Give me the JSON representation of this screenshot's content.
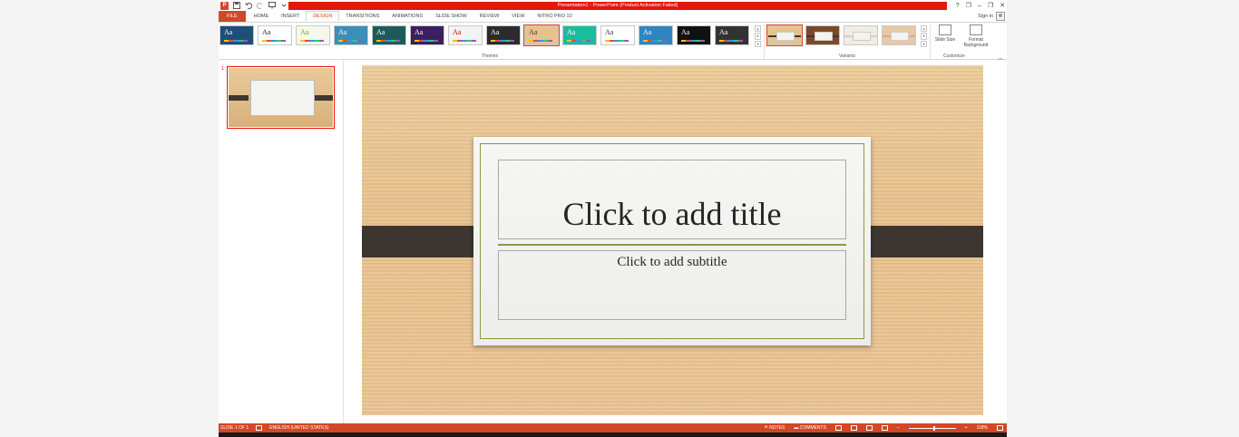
{
  "window": {
    "title": "Presentation1 - PowerPoint (Product Activation Failed)",
    "app_logo": "P",
    "controls": [
      "?",
      "❐",
      "–",
      "❐",
      "✕"
    ]
  },
  "tabs": [
    {
      "label": "FILE"
    },
    {
      "label": "HOME"
    },
    {
      "label": "INSERT"
    },
    {
      "label": "DESIGN"
    },
    {
      "label": "TRANSITIONS"
    },
    {
      "label": "ANIMATIONS"
    },
    {
      "label": "SLIDE SHOW"
    },
    {
      "label": "REVIEW"
    },
    {
      "label": "VIEW"
    },
    {
      "label": "NITRO PRO 10"
    }
  ],
  "active_tab": "DESIGN",
  "signin": {
    "label": "Sign in"
  },
  "ribbon": {
    "groups": {
      "themes": "Themes",
      "variants": "Variants",
      "customize": "Customize"
    },
    "themes": [
      {
        "label": "Aa",
        "bg": "#1f4e79",
        "fg": "#ffffff"
      },
      {
        "label": "Aa",
        "bg": "#ffffff",
        "fg": "#222222"
      },
      {
        "label": "Aa",
        "bg": "#f4f8ea",
        "fg": "#7aa02c"
      },
      {
        "label": "Aa",
        "bg": "#3a8fb7",
        "fg": "#ffffff"
      },
      {
        "label": "Aa",
        "bg": "#1f5a5a",
        "fg": "#ffffff"
      },
      {
        "label": "Aa",
        "bg": "#3b1f5e",
        "fg": "#ffffff"
      },
      {
        "label": "Aa",
        "bg": "#f3f3f3",
        "fg": "#c00000"
      },
      {
        "label": "Aa",
        "bg": "#2b2b2b",
        "fg": "#ffffff"
      },
      {
        "label": "Aa",
        "bg": "#e7c28e",
        "fg": "#3d3630"
      },
      {
        "label": "Aa",
        "bg": "#1abc9c",
        "fg": "#ffffff"
      },
      {
        "label": "Aa",
        "bg": "#ffffff",
        "fg": "#333333"
      },
      {
        "label": "Aa",
        "bg": "#2e86c1",
        "fg": "#ffffff"
      },
      {
        "label": "Aa",
        "bg": "#111111",
        "fg": "#ffffff"
      },
      {
        "label": "Aa",
        "bg": "#333333",
        "fg": "#ffffff"
      }
    ],
    "variants": [
      {
        "bg": "#e7c28e",
        "stripe": "#3d3630"
      },
      {
        "bg": "#7b4a2a",
        "stripe": "#3d3630"
      },
      {
        "bg": "#f1ece4",
        "stripe": "#d8cfc2"
      },
      {
        "bg": "#e7c9a6",
        "stripe": "#cfb08a"
      }
    ],
    "customize": {
      "slide_size": "Slide Size",
      "format_background": "Format Background"
    }
  },
  "thumbnails": {
    "number": "1"
  },
  "slide": {
    "title_placeholder": "Click to add title",
    "subtitle_placeholder": "Click to add subtitle"
  },
  "status": {
    "slide": "SLIDE 1 OF 1",
    "language": "ENGLISH (UNITED STATES)",
    "notes": "NOTES",
    "comments": "COMMENTS",
    "zoom": "118%",
    "zoom_fraction": 0.55
  },
  "colors": {
    "accent": "#d24726",
    "title_bar": "#e3160b"
  }
}
